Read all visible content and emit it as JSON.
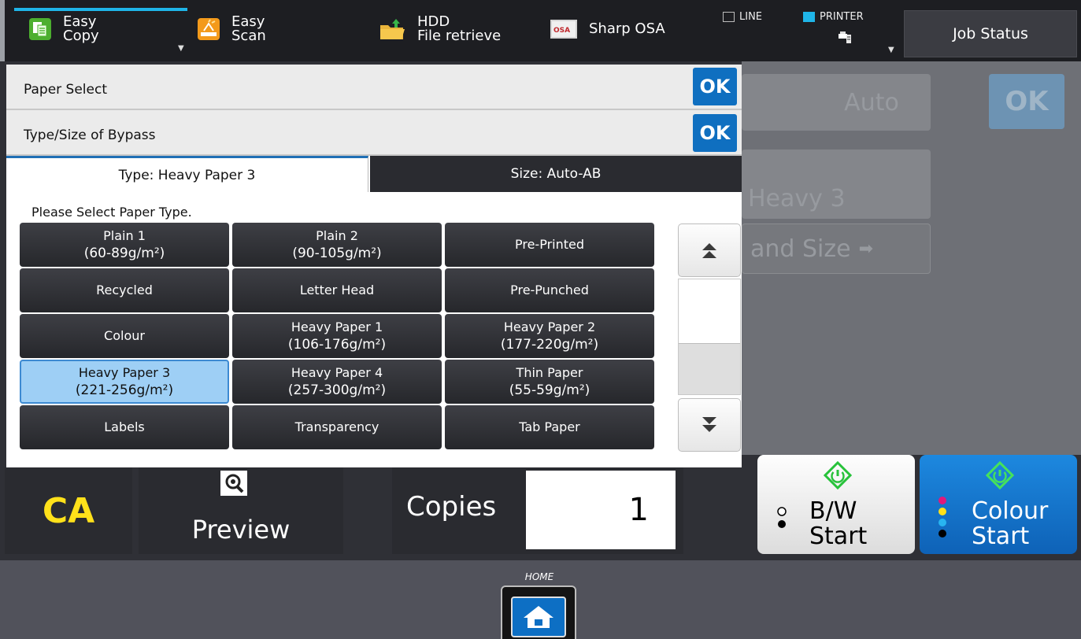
{
  "topbar": {
    "easy_copy_line1": "Easy",
    "easy_copy_line2": "Copy",
    "easy_scan_line1": "Easy",
    "easy_scan_line2": "Scan",
    "hdd_line1": "HDD",
    "hdd_line2": "File retrieve",
    "sharp_osa": "Sharp OSA",
    "osa_icon_text": "OSA",
    "line_label": "LINE",
    "printer_label": "PRINTER",
    "job_status": "Job Status"
  },
  "background": {
    "auto_label": "Auto",
    "ok_label": "OK",
    "heavy_label": "Heavy 3",
    "type_size_label": "and Size"
  },
  "dialog": {
    "paper_select": "Paper Select",
    "paper_select_ok": "OK",
    "type_size_bypass": "Type/Size of Bypass",
    "type_size_ok": "OK",
    "tab_type": "Type:  Heavy Paper 3",
    "tab_size": "Size:  Auto-AB",
    "prompt": "Please Select Paper Type.",
    "paper_types": [
      {
        "line1": "Plain 1",
        "line2": "(60-89g/m²)"
      },
      {
        "line1": "Plain 2",
        "line2": "(90-105g/m²)"
      },
      {
        "line1": "Pre-Printed",
        "line2": ""
      },
      {
        "line1": "Recycled",
        "line2": ""
      },
      {
        "line1": "Letter Head",
        "line2": ""
      },
      {
        "line1": "Pre-Punched",
        "line2": ""
      },
      {
        "line1": "Colour",
        "line2": ""
      },
      {
        "line1": "Heavy Paper 1",
        "line2": "(106-176g/m²)"
      },
      {
        "line1": "Heavy Paper 2",
        "line2": "(177-220g/m²)"
      },
      {
        "line1": "Heavy Paper 3",
        "line2": "(221-256g/m²)"
      },
      {
        "line1": "Heavy Paper 4",
        "line2": "(257-300g/m²)"
      },
      {
        "line1": "Thin Paper",
        "line2": "(55-59g/m²)"
      },
      {
        "line1": "Labels",
        "line2": ""
      },
      {
        "line1": "Transparency",
        "line2": ""
      },
      {
        "line1": "Tab Paper",
        "line2": ""
      }
    ],
    "selected_type": "Heavy Paper 3"
  },
  "controls": {
    "ca": "CA",
    "preview": "Preview",
    "copies_label": "Copies",
    "copies_value": "1",
    "bw_line1": "B/W",
    "bw_line2": "Start",
    "colour_line1": "Colour",
    "colour_line2": "Start"
  },
  "home": {
    "label": "HOME"
  },
  "colors": {
    "accent": "#1fb5e8",
    "ok_blue": "#0f6fc0",
    "selected_type": "#9ecff5",
    "ca_yellow": "#ffe11a",
    "colour_start": "#1d88df"
  },
  "icons": {
    "easy_copy": "copy-icon",
    "easy_scan": "scan-icon",
    "hdd": "folder-icon",
    "sharp_osa": "osa-icon",
    "printer": "printer-icon",
    "preview": "magnifier-icon",
    "start": "start-icon",
    "home": "home-icon",
    "scroll_up": "double-chevron-up-icon",
    "scroll_down": "double-chevron-down-icon"
  }
}
